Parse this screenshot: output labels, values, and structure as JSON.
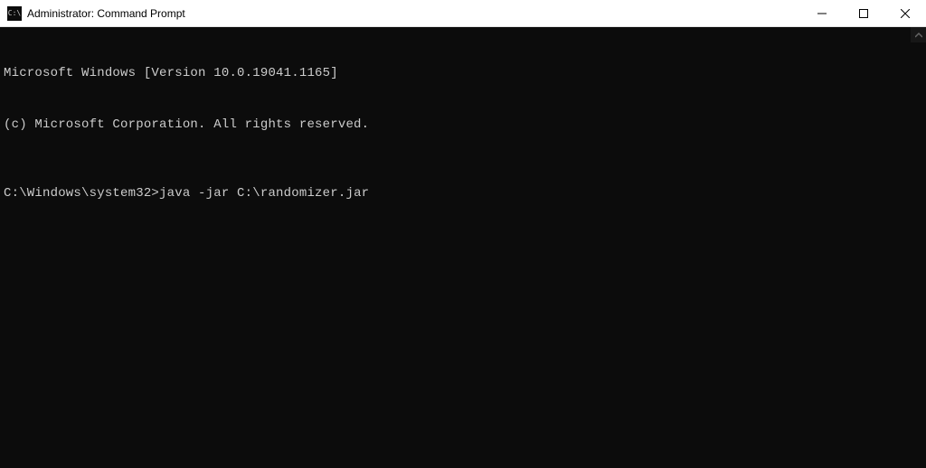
{
  "titlebar": {
    "title": "Administrator: Command Prompt",
    "icon_label": "cmd-icon"
  },
  "terminal": {
    "line1": "Microsoft Windows [Version 10.0.19041.1165]",
    "line2": "(c) Microsoft Corporation. All rights reserved.",
    "prompt": "C:\\Windows\\system32>",
    "command": "java -jar C:\\randomizer.jar"
  }
}
